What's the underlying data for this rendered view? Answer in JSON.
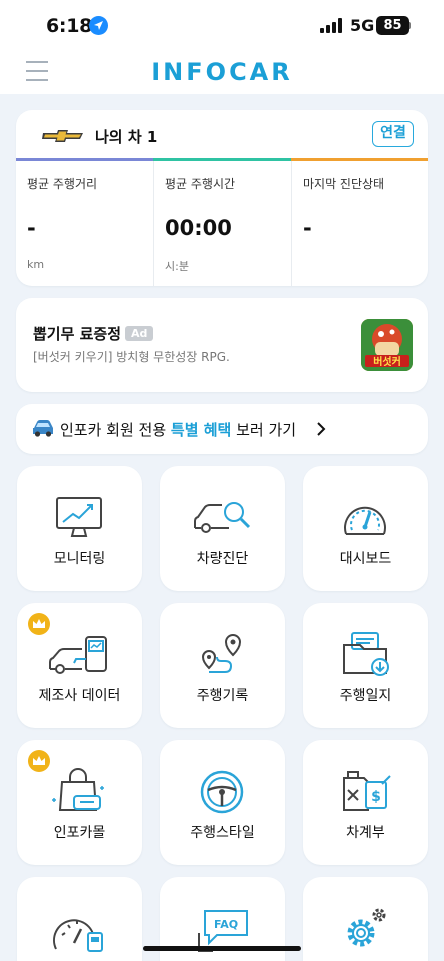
{
  "status_bar": {
    "time": "6:18",
    "network": "5G",
    "battery": "85"
  },
  "header": {
    "logo": "INFOCAR"
  },
  "my_car": {
    "name": "나의 차 1",
    "connect_label": "연결",
    "stats": [
      {
        "label": "평균 주행거리",
        "value": "-",
        "unit": "km",
        "color": "#7a87d6"
      },
      {
        "label": "평균 주행시간",
        "value": "00:00",
        "unit": "시:분",
        "color": "#2fc3a3"
      },
      {
        "label": "마지막 진단상태",
        "value": "-",
        "unit": "",
        "color": "#f0a030"
      }
    ]
  },
  "ad": {
    "title": "뽑기무 료증정",
    "badge": "Ad",
    "description": "[버섯커 키우기] 방치형 무한성장 RPG.",
    "thumb_text": "버섯커"
  },
  "promo": {
    "prefix": "인포카 회원 전용 ",
    "highlight": "특별 혜택",
    "suffix": " 보러 가기"
  },
  "menu": [
    {
      "label": "모니터링",
      "icon": "monitor-chart-icon",
      "premium": false
    },
    {
      "label": "차량진단",
      "icon": "car-search-icon",
      "premium": false
    },
    {
      "label": "대시보드",
      "icon": "speedometer-icon",
      "premium": false
    },
    {
      "label": "제조사 데이터",
      "icon": "car-scanner-icon",
      "premium": true
    },
    {
      "label": "주행기록",
      "icon": "route-pin-icon",
      "premium": false
    },
    {
      "label": "주행일지",
      "icon": "folder-download-icon",
      "premium": false
    },
    {
      "label": "인포카몰",
      "icon": "shopping-bag-icon",
      "premium": true
    },
    {
      "label": "주행스타일",
      "icon": "steering-wheel-icon",
      "premium": false
    },
    {
      "label": "차계부",
      "icon": "fuel-receipt-icon",
      "premium": false
    },
    {
      "label": "",
      "icon": "gauge-fuel-icon",
      "premium": false
    },
    {
      "label": "",
      "icon": "faq-chat-icon",
      "premium": false
    },
    {
      "label": "",
      "icon": "settings-gears-icon",
      "premium": false
    }
  ],
  "colors": {
    "brand": "#1b9fd6",
    "accent_icon": "#2aa4d8",
    "crown": "#f1b318",
    "background": "#eef3f9"
  }
}
